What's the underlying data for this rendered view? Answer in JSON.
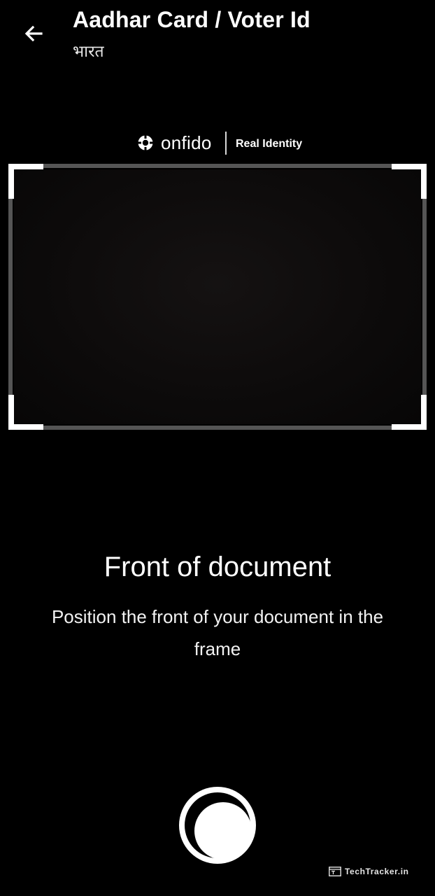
{
  "header": {
    "title": "Aadhar Card / Voter Id",
    "subtitle": "भारत"
  },
  "branding": {
    "wordmark": "onfido",
    "tagline": "Real Identity"
  },
  "instruction": {
    "title": "Front of document",
    "body": "Position the front of your document in the frame"
  },
  "watermark": {
    "text": "TechTracker.in"
  },
  "icons": {
    "back": "arrow-left-icon",
    "shutter": "camera-shutter-icon",
    "brand": "onfido-logo-icon"
  },
  "colors": {
    "background": "#000000",
    "frame_corner": "#ffffff",
    "frame_edge": "#555555",
    "text": "#ffffff"
  }
}
